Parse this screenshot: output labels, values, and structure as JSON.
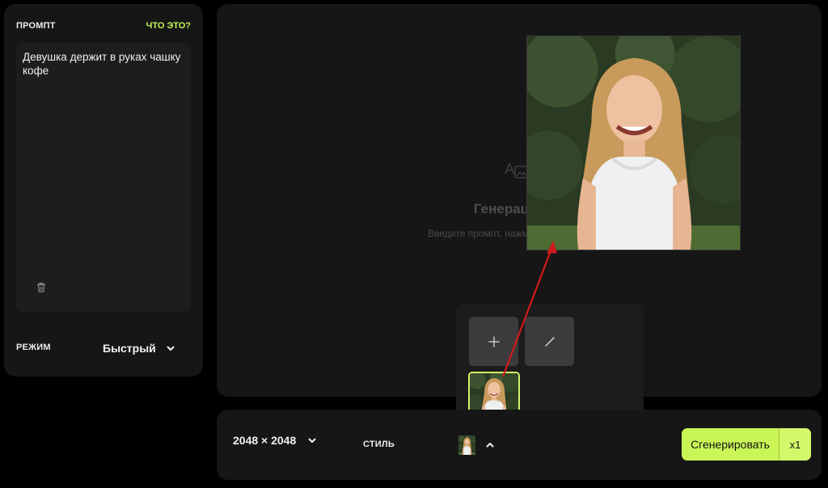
{
  "left_panel": {
    "title": "ПРОМПТ",
    "help_link": "ЧТО ЭТО?",
    "prompt_text": "Девушка держит в руках чашку кофе",
    "mode_label": "РЕЖИМ",
    "mode_value": "Быстрый"
  },
  "canvas": {
    "empty_title": "Генерация из",
    "empty_hint": "Введите промпт, нажмите «Сгенерирова"
  },
  "bottom_bar": {
    "size_value": "2048 × 2048",
    "style_label": "СТИЛЬ",
    "generate_label": "Сгенерировать",
    "count_label": "x1"
  },
  "colors": {
    "accent": "#c9f557",
    "panel": "#161616",
    "background": "#000000",
    "annotation_arrow": "#d11a1a"
  },
  "icons": [
    "trash-icon",
    "chevron-down-icon",
    "image-text-icon",
    "plus-icon",
    "pencil-icon",
    "chevron-up-icon"
  ]
}
